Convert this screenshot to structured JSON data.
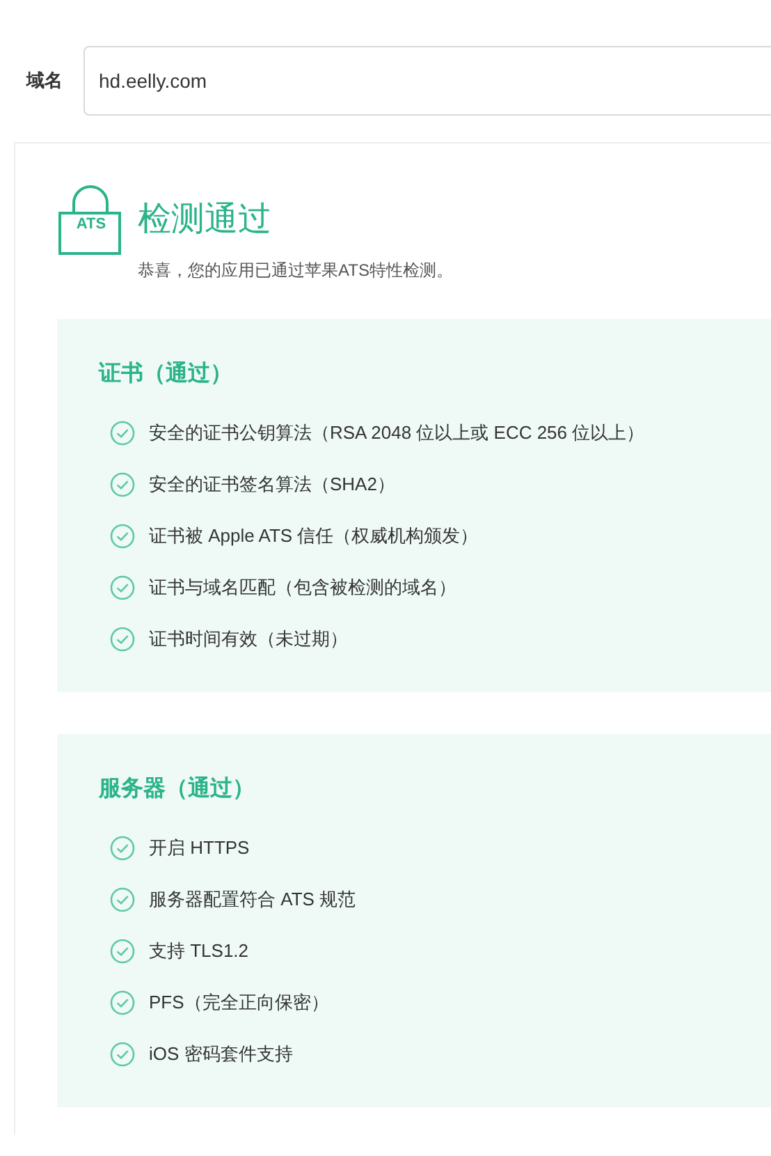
{
  "domain_field": {
    "label": "域名",
    "value": "hd.eelly.com"
  },
  "result": {
    "badge": "ATS",
    "title": "检测通过",
    "message": "恭喜，您的应用已通过苹果ATS特性检测。"
  },
  "sections": [
    {
      "title": "证书（通过）",
      "items": [
        "安全的证书公钥算法（RSA 2048 位以上或 ECC 256 位以上）",
        "安全的证书签名算法（SHA2）",
        "证书被 Apple ATS 信任（权威机构颁发）",
        "证书与域名匹配（包含被检测的域名）",
        "证书时间有效（未过期）"
      ]
    },
    {
      "title": "服务器（通过）",
      "items": [
        "开启 HTTPS",
        "服务器配置符合 ATS 规范",
        "支持 TLS1.2",
        "PFS（完全正向保密）",
        "iOS 密码套件支持"
      ]
    }
  ]
}
